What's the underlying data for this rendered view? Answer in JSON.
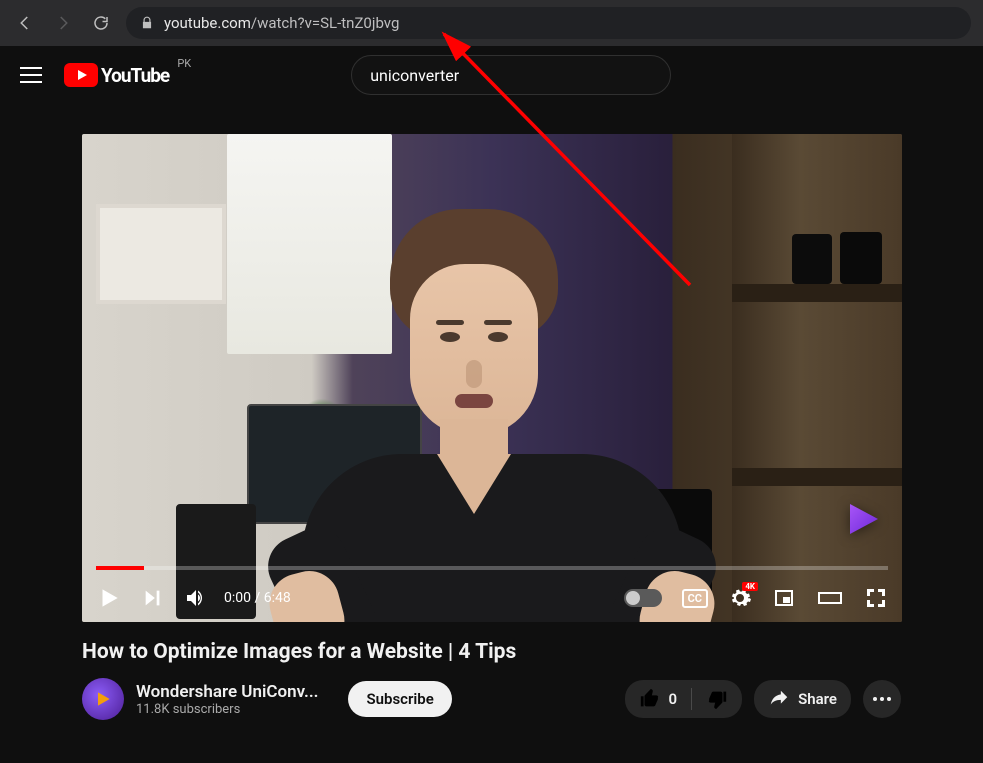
{
  "browser": {
    "url_domain": "youtube.com",
    "url_path": "/watch?v=SL-tnZ0jbvg"
  },
  "header": {
    "logo_text": "YouTube",
    "country_code": "PK",
    "search_query": "uniconverter"
  },
  "player": {
    "current_time": "0:00",
    "duration": "6:48",
    "settings_badge": "4K",
    "cc_label": "CC"
  },
  "video": {
    "title": "How to Optimize Images for a Website | 4 Tips",
    "channel_name": "Wondershare UniConv...",
    "subscriber_count": "11.8K subscribers",
    "subscribe_label": "Subscribe",
    "like_count": "0",
    "share_label": "Share"
  }
}
